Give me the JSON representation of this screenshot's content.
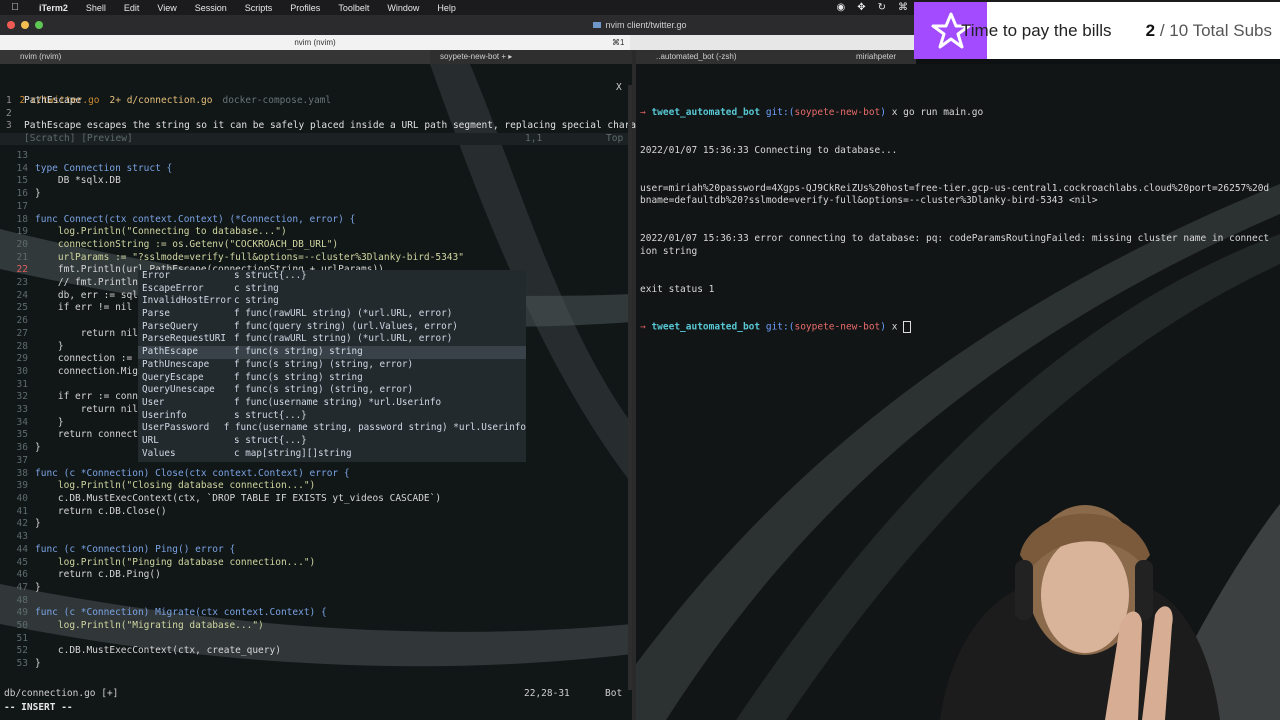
{
  "menubar": {
    "app": "iTerm2",
    "items": [
      "Shell",
      "Edit",
      "View",
      "Session",
      "Scripts",
      "Profiles",
      "Toolbelt",
      "Window",
      "Help"
    ]
  },
  "window": {
    "title": "nvim client/twitter.go",
    "tab_active": "nvim (nvim)",
    "tab_shortcut": "⌘1",
    "left_pane_header": "nvim (nvim)",
    "right_pane_header": "..automated_bot (-zsh)",
    "branch_header": "soypete-new-bot",
    "user_header": "miriahpeter"
  },
  "vim": {
    "buffers": [
      "2 c/twitter.go",
      "2+ d/connection.go",
      "docker-compose.yaml"
    ],
    "close_marker": "X",
    "doc_title": "PathEscape",
    "doc_text": "PathEscape escapes the string so it can be safely placed inside a URL path segment, replacing special charact",
    "scratch_label": "[Scratch] [Preview]",
    "scratch_pos": "1,1",
    "scratch_top": "Top",
    "status_file": "db/connection.go [+]",
    "status_pos": "22,28-31",
    "status_bot": "Bot",
    "mode": "-- INSERT --",
    "code_lines": [
      [
        "13",
        ""
      ],
      [
        "14",
        "type Connection struct {"
      ],
      [
        "15",
        "    DB *sqlx.DB"
      ],
      [
        "16",
        "}"
      ],
      [
        "17",
        ""
      ],
      [
        "18",
        "func Connect(ctx context.Context) (*Connection, error) {"
      ],
      [
        "19",
        "    log.Println(\"Connecting to database...\")"
      ],
      [
        "20",
        "    connectionString := os.Getenv(\"COCKROACH_DB_URL\")"
      ],
      [
        "21",
        "    urlParams := \"?sslmode=verify-full&options=--cluster%3Dlanky-bird-5343\""
      ],
      [
        "22",
        "    fmt.Println(url.PathEscape(connectionString + urlParams))"
      ],
      [
        "23",
        "    // fmt.Println("
      ],
      [
        "24",
        "    db, err := sqlx"
      ],
      [
        "25",
        "    if err != nil {"
      ],
      [
        "26",
        ""
      ],
      [
        "27",
        "        return nil,"
      ],
      [
        "28",
        "    }"
      ],
      [
        "29",
        "    connection := &"
      ],
      [
        "30",
        "    connection.Migr"
      ],
      [
        "31",
        ""
      ],
      [
        "32",
        "    if err := conne"
      ],
      [
        "33",
        "        return nil,"
      ],
      [
        "34",
        "    }"
      ],
      [
        "35",
        "    return connecti"
      ],
      [
        "36",
        "}"
      ],
      [
        "37",
        ""
      ],
      [
        "38",
        "func (c *Connection) Close(ctx context.Context) error {"
      ],
      [
        "39",
        "    log.Println(\"Closing database connection...\")"
      ],
      [
        "40",
        "    c.DB.MustExecContext(ctx, `DROP TABLE IF EXISTS yt_videos CASCADE`)"
      ],
      [
        "41",
        "    return c.DB.Close()"
      ],
      [
        "42",
        "}"
      ],
      [
        "43",
        ""
      ],
      [
        "44",
        "func (c *Connection) Ping() error {"
      ],
      [
        "45",
        "    log.Println(\"Pinging database connection...\")"
      ],
      [
        "46",
        "    return c.DB.Ping()"
      ],
      [
        "47",
        "}"
      ],
      [
        "48",
        ""
      ],
      [
        "49",
        "func (c *Connection) Migrate(ctx context.Context) {"
      ],
      [
        "50",
        "    log.Println(\"Migrating database...\")"
      ],
      [
        "51",
        ""
      ],
      [
        "52",
        "    c.DB.MustExecContext(ctx, create_query)"
      ],
      [
        "53",
        "}"
      ]
    ],
    "completions": [
      [
        "Error",
        "s struct{...}"
      ],
      [
        "EscapeError",
        "c string"
      ],
      [
        "InvalidHostError",
        "c string"
      ],
      [
        "Parse",
        "f func(rawURL string) (*url.URL, error)"
      ],
      [
        "ParseQuery",
        "f func(query string) (url.Values, error)"
      ],
      [
        "ParseRequestURI",
        "f func(rawURL string) (*url.URL, error)"
      ],
      [
        "PathEscape",
        "f func(s string) string"
      ],
      [
        "PathUnescape",
        "f func(s string) (string, error)"
      ],
      [
        "QueryEscape",
        "f func(s string) string"
      ],
      [
        "QueryUnescape",
        "f func(s string) (string, error)"
      ],
      [
        "User",
        "f func(username string) *url.Userinfo"
      ],
      [
        "Userinfo",
        "s struct{...}"
      ],
      [
        "UserPassword",
        "f func(username string, password string) *url.Userinfo"
      ],
      [
        "URL",
        "s struct{...}"
      ],
      [
        "Values",
        "c map[string][]string"
      ]
    ],
    "selected_completion": 6
  },
  "terminal": {
    "prompt_dir": "tweet_automated_bot",
    "git_label": "git:(",
    "branch": "soypete-new-bot",
    "git_close": ")",
    "cmd": "x go run main.go",
    "output": [
      "2022/01/07 15:36:33 Connecting to database...",
      "user=miriah%20password=4Xgps-QJ9CkReiZUs%20host=free-tier.gcp-us-central1.cockroachlabs.cloud%20port=26257%20dbname=defaultdb%20?sslmode=verify-full&options=--cluster%3Dlanky-bird-5343 <nil>",
      "2022/01/07 15:36:33 error connecting to database: pq: codeParamsRoutingFailed: missing cluster name in connection string",
      "exit status 1"
    ],
    "prompt2_symbol": "x"
  },
  "sub_overlay": {
    "title": "Time to pay the bills",
    "current": "2",
    "sep": "/",
    "total_label": "10 Total Subs",
    "accent": "#a24bff"
  }
}
